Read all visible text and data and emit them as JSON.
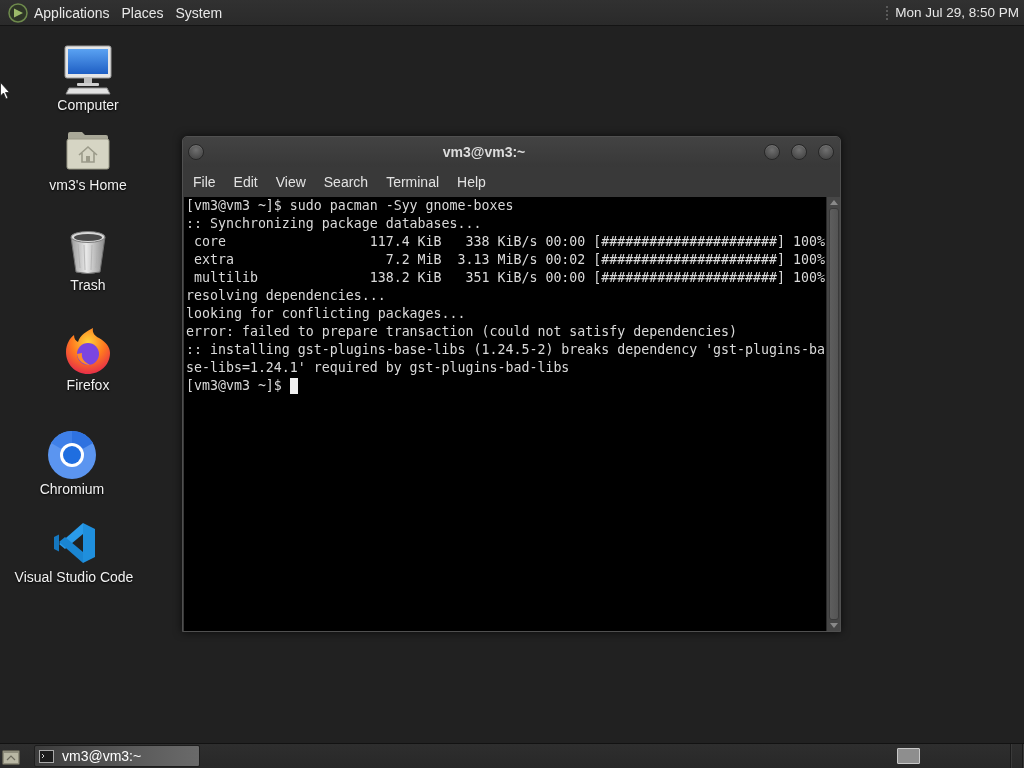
{
  "top_panel": {
    "menus": [
      "Applications",
      "Places",
      "System"
    ],
    "clock": "Mon Jul 29, 8:50 PM"
  },
  "desktop_icons": [
    {
      "kind": "computer",
      "label": "Computer"
    },
    {
      "kind": "home",
      "label": "vm3's Home"
    },
    {
      "kind": "trash",
      "label": "Trash"
    },
    {
      "kind": "flame",
      "label": "Firefox"
    },
    {
      "kind": "ring",
      "label": "Chromium"
    },
    {
      "kind": "ribbon",
      "label": "Visual Studio Code"
    }
  ],
  "terminal_window": {
    "title": "vm3@vm3:~",
    "menu": [
      "File",
      "Edit",
      "View",
      "Search",
      "Terminal",
      "Help"
    ],
    "lines": [
      "[vm3@vm3 ~]$ sudo pacman -Syy gnome-boxes",
      ":: Synchronizing package databases...",
      " core                  117.4 KiB   338 KiB/s 00:00 [######################] 100%",
      " extra                   7.2 MiB  3.13 MiB/s 00:02 [######################] 100%",
      " multilib              138.2 KiB   351 KiB/s 00:00 [######################] 100%",
      "resolving dependencies...",
      "looking for conflicting packages...",
      "error: failed to prepare transaction (could not satisfy dependencies)",
      ":: installing gst-plugins-base-libs (1.24.5-2) breaks dependency 'gst-plugins-ba",
      "se-libs=1.24.1' required by gst-plugins-bad-libs"
    ],
    "prompt": "[vm3@vm3 ~]$"
  },
  "taskbar": {
    "tasks": [
      {
        "label": "vm3@vm3:~",
        "selected": true
      }
    ]
  }
}
